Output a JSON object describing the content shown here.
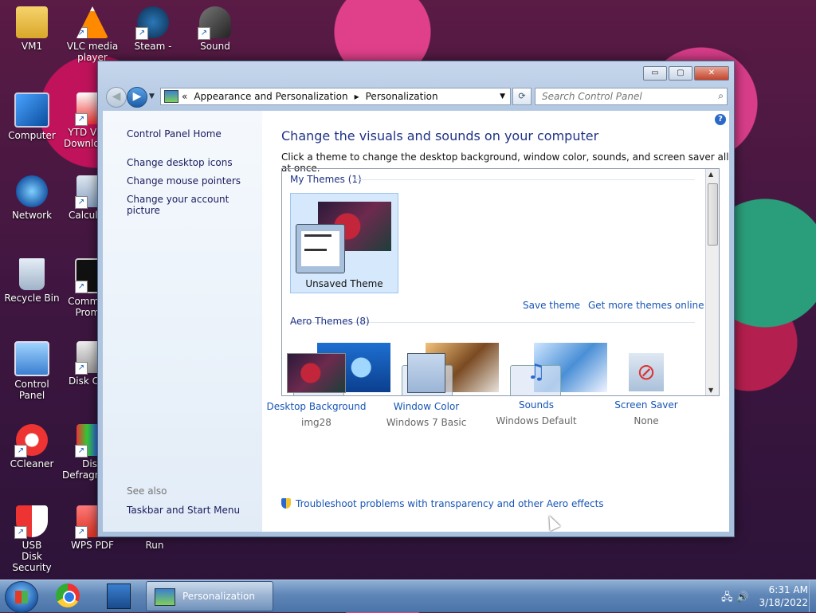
{
  "desktop": {
    "icons": [
      {
        "label": "VM1"
      },
      {
        "label": "VLC media player"
      },
      {
        "label": "Steam -"
      },
      {
        "label": "Sound"
      },
      {
        "label": "Computer"
      },
      {
        "label": "YTD Video Downloader"
      },
      {
        "label": "Network"
      },
      {
        "label": "Calculator"
      },
      {
        "label": "Recycle Bin"
      },
      {
        "label": "Command Prompt"
      },
      {
        "label": "Control Panel"
      },
      {
        "label": "Disk Cleanup"
      },
      {
        "label": "CCleaner"
      },
      {
        "label": "Disk Defragmenter"
      },
      {
        "label": "USB Disk Security"
      },
      {
        "label": "WPS PDF"
      },
      {
        "label": "Run"
      }
    ]
  },
  "window": {
    "controls": {
      "minimize": "▭",
      "maximize": "▢",
      "close": "✕"
    },
    "address": {
      "prefix": "«",
      "crumbs": [
        "Appearance and Personalization",
        "Personalization"
      ],
      "separator": "▸"
    },
    "search": {
      "placeholder": "Search Control Panel"
    },
    "left_pane": {
      "home": "Control Panel Home",
      "links": [
        "Change desktop icons",
        "Change mouse pointers",
        "Change your account picture"
      ],
      "see_also": "See also",
      "see_also_links": [
        "Taskbar and Start Menu"
      ]
    },
    "main": {
      "heading": "Change the visuals and sounds on your computer",
      "subtitle": "Click a theme to change the desktop background, window color, sounds, and screen saver all at once.",
      "my_themes_label": "My Themes (1)",
      "selected_theme": "Unsaved Theme",
      "save_theme": "Save theme",
      "get_more": "Get more themes online",
      "aero_themes_label": "Aero Themes (8)",
      "settings": [
        {
          "title": "Desktop Background",
          "value": "img28"
        },
        {
          "title": "Window Color",
          "value": "Windows 7 Basic"
        },
        {
          "title": "Sounds",
          "value": "Windows Default"
        },
        {
          "title": "Screen Saver",
          "value": "None"
        }
      ],
      "troubleshoot": "Troubleshoot problems with transparency and other Aero effects",
      "help": "?"
    }
  },
  "taskbar": {
    "active_window": "Personalization",
    "time": "6:31 AM",
    "date": "3/18/2022"
  }
}
